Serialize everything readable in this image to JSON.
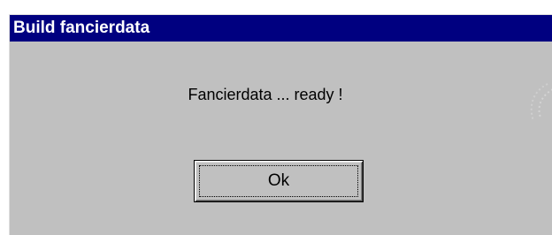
{
  "dialog": {
    "title": "Build fancierdata",
    "message": "Fancierdata ... ready !",
    "ok_label": "Ok"
  },
  "colors": {
    "title_bar": "#000080",
    "title_text": "#ffffff",
    "dialog_face": "#c0c0c0"
  }
}
